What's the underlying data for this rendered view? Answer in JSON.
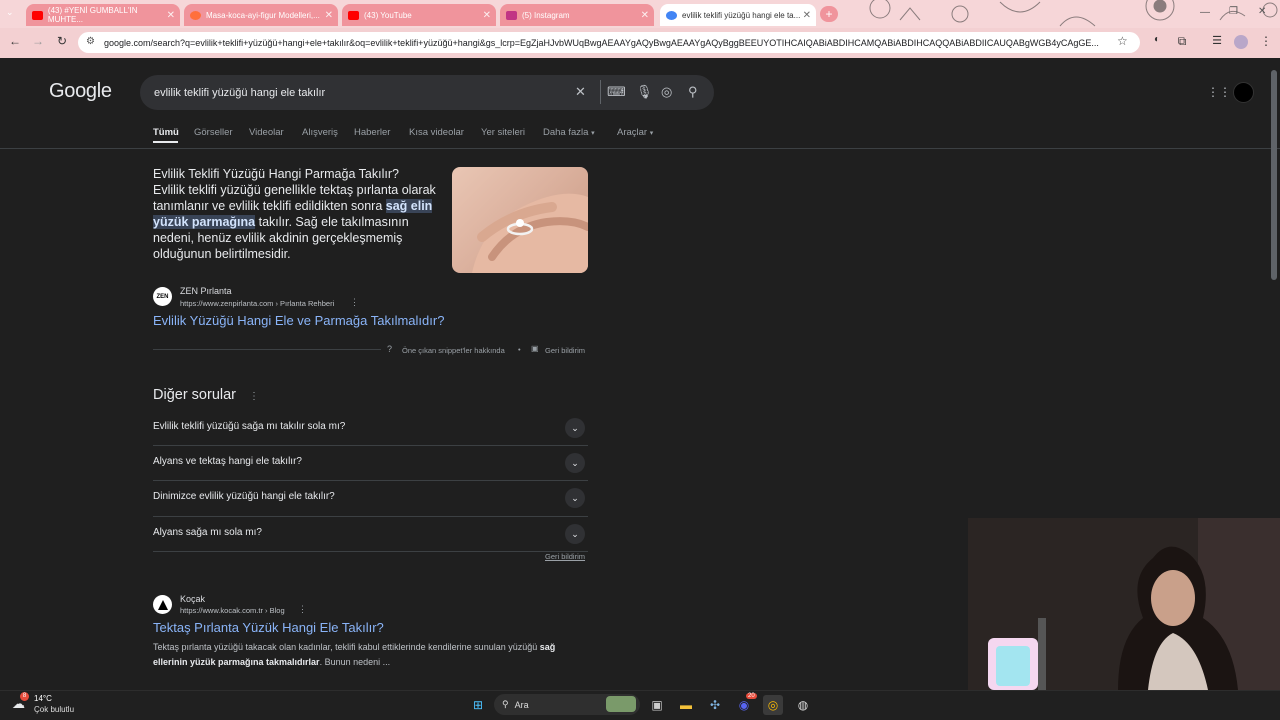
{
  "browser": {
    "tabs": [
      {
        "title": "(43) #YENİ GUMBALL'IN MUHTE...",
        "favicon": "youtube-icon",
        "color": "#ff0000"
      },
      {
        "title": "Masa-koca-ayi-figur Modelleri,...",
        "favicon": "shop-icon",
        "color": "#ff6f3c"
      },
      {
        "title": "(43) YouTube",
        "favicon": "youtube-icon",
        "color": "#ff0000"
      },
      {
        "title": "(5) Instagram",
        "favicon": "instagram-icon",
        "color": "#c13584"
      },
      {
        "title": "evlilik teklifi yüzüğü hangi ele ta...",
        "favicon": "google-icon",
        "color": "#4285f4"
      }
    ],
    "new_tab": "+",
    "url": "google.com/search?q=evlilik+teklifi+yüzüğü+hangi+ele+takılır&oq=evlilik+teklifi+yüzüğü+hangi&gs_lcrp=EgZjaHJvbWUqBwgAEAAYgAQyBwgAEAAYgAQyBggBEEUYOTIHCAIQABiABDIHCAMQABiABDIHCAQQABiABDIICAUQABgWGB4yCAgGE..."
  },
  "google": {
    "logo": "Google",
    "query": "evlilik teklifi yüzüğü hangi ele takılır",
    "tabs": [
      "Tümü",
      "Görseller",
      "Videolar",
      "Alışveriş",
      "Haberler",
      "Kısa videolar",
      "Yer siteleri",
      "Daha fazla",
      "Araçlar"
    ],
    "snippet": {
      "title": "Evlilik Teklifi Yüzüğü Hangi Parmağa Takılır?",
      "text_before": "Evlilik teklifi yüzüğü genellikle tektaş pırlanta olarak tanımlanır ve evlilik teklifi edildikten sonra",
      "highlight": "sağ elin yüzük parmağına",
      "text_after": "takılır. Sağ ele takılmasının nedeni, henüz evlilik akdinin gerçekleşmemiş olduğunun belirtilmesidir.",
      "source_name": "ZEN Pırlanta",
      "source_fav": "ZEN",
      "source_url": "https://www.zenpirlanta.com › Pırlanta Rehberi",
      "link": "Evlilik Yüzüğü Hangi Ele ve Parmağa Takılmalıdır?",
      "about": "Öne çıkan snippet'ler hakkında",
      "feedback": "Geri bildirim"
    },
    "paa": {
      "title": "Diğer sorular",
      "questions": [
        "Evlilik teklifi yüzüğü sağa mı takılır sola mı?",
        "Alyans ve tektaş hangi ele takılır?",
        "Dinimizce evlilik yüzüğü hangi ele takılır?",
        "Alyans sağa mı sola mı?"
      ],
      "feedback": "Geri bildirim"
    },
    "result2": {
      "source_name": "Koçak",
      "source_url": "https://www.kocak.com.tr › Blog",
      "link": "Tektaş Pırlanta Yüzük Hangi Ele Takılır?",
      "desc_before": "Tektaş pırlanta yüzüğü takacak olan kadınlar, teklifi kabul ettiklerinde kendilerine sunulan yüzüğü",
      "desc_bold": "sağ ellerinin yüzük parmağına takmalıdırlar",
      "desc_after": ". Bunun nedeni ..."
    }
  },
  "taskbar": {
    "weather_temp": "14°C",
    "weather_desc": "Çok bulutlu",
    "badge": "8",
    "search_placeholder": "Ara",
    "discord_badge": "20"
  }
}
